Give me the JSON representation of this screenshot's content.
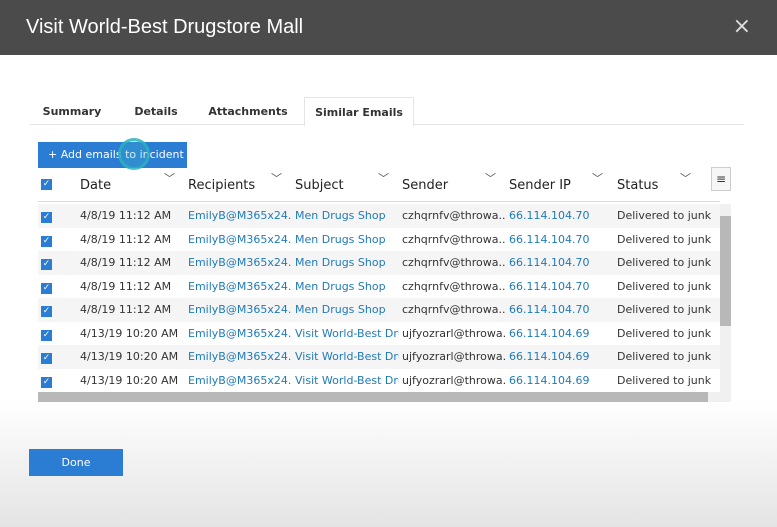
{
  "dialog": {
    "title": "Visit World-Best Drugstore Mall",
    "close_icon": "×"
  },
  "tabs": [
    {
      "label": "Summary"
    },
    {
      "label": "Details"
    },
    {
      "label": "Attachments"
    },
    {
      "label": "Similar Emails",
      "active": true
    }
  ],
  "toolbar": {
    "add_label": "+ Add emails to incident"
  },
  "columns": [
    "Date",
    "Recipients",
    "Subject",
    "Sender",
    "Sender IP",
    "Status"
  ],
  "rows": [
    {
      "date": "4/8/19 11:12 AM",
      "recipient": "EmilyB@M365x24...",
      "subject": "Men Drugs Shop",
      "sender": "czhqrnfv@throwa...",
      "ip": "66.114.104.70",
      "status": "Delivered to junk"
    },
    {
      "date": "4/8/19 11:12 AM",
      "recipient": "EmilyB@M365x24...",
      "subject": "Men Drugs Shop",
      "sender": "czhqrnfv@throwa...",
      "ip": "66.114.104.70",
      "status": "Delivered to junk"
    },
    {
      "date": "4/8/19 11:12 AM",
      "recipient": "EmilyB@M365x24...",
      "subject": "Men Drugs Shop",
      "sender": "czhqrnfv@throwa...",
      "ip": "66.114.104.70",
      "status": "Delivered to junk"
    },
    {
      "date": "4/8/19 11:12 AM",
      "recipient": "EmilyB@M365x24...",
      "subject": "Men Drugs Shop",
      "sender": "czhqrnfv@throwa...",
      "ip": "66.114.104.70",
      "status": "Delivered to junk"
    },
    {
      "date": "4/8/19 11:12 AM",
      "recipient": "EmilyB@M365x24...",
      "subject": "Men Drugs Shop",
      "sender": "czhqrnfv@throwa...",
      "ip": "66.114.104.70",
      "status": "Delivered to junk"
    },
    {
      "date": "4/13/19 10:20 AM",
      "recipient": "EmilyB@M365x24...",
      "subject": "Visit World-Best Drug",
      "sender": "ujfyozrarl@throwa...",
      "ip": "66.114.104.69",
      "status": "Delivered to junk"
    },
    {
      "date": "4/13/19 10:20 AM",
      "recipient": "EmilyB@M365x24...",
      "subject": "Visit World-Best Drug",
      "sender": "ujfyozrarl@throwa...",
      "ip": "66.114.104.69",
      "status": "Delivered to junk"
    },
    {
      "date": "4/13/19 10:20 AM",
      "recipient": "EmilyB@M365x24...",
      "subject": "Visit World-Best Drug",
      "sender": "ujfyozrarl@throwa...",
      "ip": "66.114.104.69",
      "status": "Delivered to junk"
    }
  ],
  "footer": {
    "done_label": "Done"
  }
}
